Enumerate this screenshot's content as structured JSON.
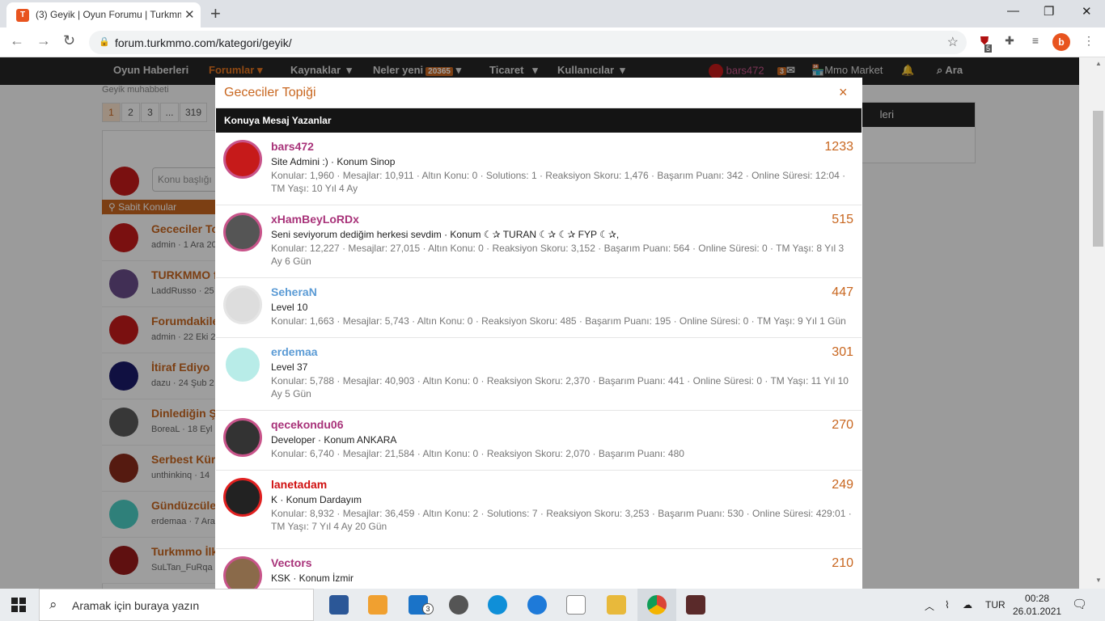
{
  "browser": {
    "tab_title": "(3) Geyik | Oyun Forumu | Turkmmo",
    "url": "forum.turkmmo.com/kategori/geyik/",
    "profile_letter": "b",
    "ext_badge": "5"
  },
  "site_nav": {
    "items": [
      "Oyun Haberleri",
      "Forumlar",
      "Kaynaklar",
      "Neler yeni",
      "Ticaret",
      "Kullanıcılar"
    ],
    "neler_yeni_badge": "20365",
    "username": "bars472",
    "msg_badge": "3",
    "market": "Mmo Market",
    "search": "Ara"
  },
  "background": {
    "breadcrumb": "Geyik muhabbeti",
    "pages": [
      "1",
      "2",
      "3",
      "...",
      "319"
    ],
    "post_placeholder": "Konu başlığı",
    "sabit_label": "Sabit Konular",
    "right_panel_title": "leri",
    "threads": [
      {
        "title": "Gececiler Topiği",
        "meta": "admin · 1 Ara 20",
        "color": "#c61a1a"
      },
      {
        "title": "TURKMMO f",
        "meta": "LaddRusso · 25",
        "color": "#6a4c8a"
      },
      {
        "title": "Forumdakile",
        "meta": "admin · 22 Eki 2",
        "color": "#c61a1a"
      },
      {
        "title": "İtiraf Ediyo",
        "meta": "dazu · 24 Şub 2",
        "color": "#1a1a6a"
      },
      {
        "title": "Dinlediğin Ş",
        "meta": "BoreaL · 18 Eyl",
        "color": "#5a5a5a"
      },
      {
        "title": "Serbest Kür",
        "meta": "unthinkinq · 14",
        "color": "#8a2a1a"
      },
      {
        "title": "Gündüzcüle",
        "meta": "erdemaa · 7 Ara",
        "color": "#4dcfc6"
      },
      {
        "title": "Turkmmo İlk",
        "meta": "SuLTan_FuRqa",
        "color": "#9a1a1a"
      }
    ]
  },
  "modal": {
    "title": "Gececiler Topiği",
    "close": "×",
    "header_bar": "Konuya Mesaj Yazanlar",
    "users": [
      {
        "name": "bars472",
        "name_color": "#a83279",
        "count": "1233",
        "title": "Site Admini :)  ·  Konum Sinop",
        "stats": "Konular: 1,960 · Mesajlar: 10,911 · Altın Konu: 0 · Solutions: 1 · Reaksiyon Skoru: 1,476 · Başarım Puanı: 342 · Online Süresi: 12:04 · TM Yaşı: 10 Yıl 4 Ay",
        "avatar_color": "#c61a1a",
        "ring": "#c8548a"
      },
      {
        "name": "xHamBeyLoRDx",
        "name_color": "#a83279",
        "count": "515",
        "title": "Seni seviyorum dediğim herkesi sevdim  ·  Konum ☾✰ TURAN ☾✰ ☾✰ FYP ☾✰,",
        "stats": "Konular: 12,227 · Mesajlar: 27,015 · Altın Konu: 0 · Reaksiyon Skoru: 3,152 · Başarım Puanı: 564 · Online Süresi: 0 · TM Yaşı: 8 Yıl 3 Ay 6 Gün",
        "avatar_color": "#555555",
        "ring": "#c8548a"
      },
      {
        "name": "SeheraN",
        "name_color": "#5b9bd5",
        "count": "447",
        "title": "Level 10",
        "stats": "Konular: 1,663 · Mesajlar: 5,743 · Altın Konu: 0 · Reaksiyon Skoru: 485 · Başarım Puanı: 195 · Online Süresi: 0 · TM Yaşı: 9 Yıl 1 Gün",
        "avatar_color": "#dddddd",
        "ring": "#e5e5e5"
      },
      {
        "name": "erdemaa",
        "name_color": "#5b9bd5",
        "count": "301",
        "title": "Level 37",
        "stats": "Konular: 5,788 · Mesajlar: 40,903 · Altın Konu: 0 · Reaksiyon Skoru: 2,370 · Başarım Puanı: 441 · Online Süresi: 0 · TM Yaşı: 11 Yıl 10 Ay 5 Gün",
        "avatar_color": "#b8ece8",
        "ring": "#ffffff"
      },
      {
        "name": "qecekondu06",
        "name_color": "#a83279",
        "count": "270",
        "title": "Developer  ·  Konum ANKARA",
        "stats": "Konular: 6,740 · Mesajlar: 21,584 · Altın Konu: 0 · Reaksiyon Skoru: 2,070 · Başarım Puanı: 480",
        "avatar_color": "#333333",
        "ring": "#c8548a"
      },
      {
        "name": "lanetadam",
        "name_color": "#d01010",
        "count": "249",
        "title": "K                     ·  Konum Dardayım",
        "stats": "Konular: 8,932 · Mesajlar: 36,459 · Altın Konu: 2 · Solutions: 7 · Reaksiyon Skoru: 3,253 · Başarım Puanı: 530 · Online Süresi: 429:01 · TM Yaşı: 7 Yıl 4 Ay 20 Gün",
        "avatar_color": "#222222",
        "ring": "#e02020"
      },
      {
        "name": "Vectors",
        "name_color": "#a83279",
        "count": "210",
        "title": "KSK  ·  Konum İzmir",
        "stats": "",
        "avatar_color": "#8a6a4a",
        "ring": "#c8548a"
      }
    ]
  },
  "taskbar": {
    "search_placeholder": "Aramak için buraya yazın",
    "mail_badge": "3",
    "lang": "TUR",
    "time": "00:28",
    "date": "26.01.2021"
  }
}
